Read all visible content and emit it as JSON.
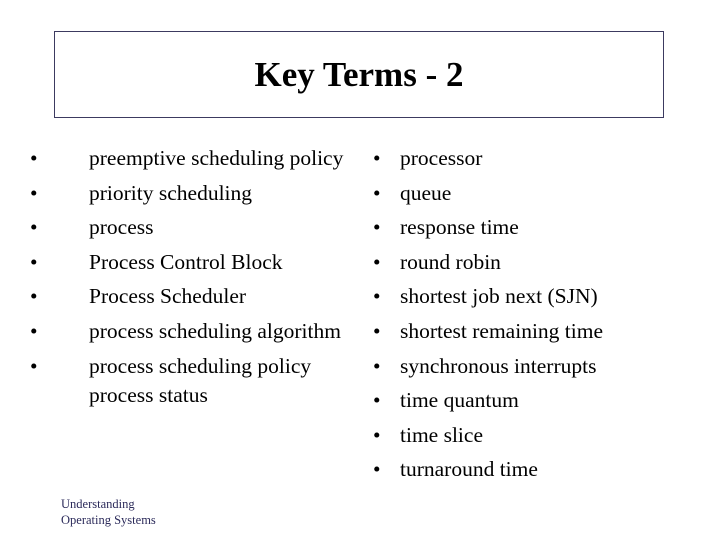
{
  "slide": {
    "title": "Key Terms - 2",
    "bullet_glyph": "•",
    "left_column": [
      "preemptive scheduling policy",
      "priority scheduling",
      "process",
      "Process Control Block",
      "Process Scheduler",
      "process scheduling algorithm",
      "process scheduling policy process status"
    ],
    "right_column": [
      "processor",
      "queue",
      "response time",
      "round robin",
      "shortest job next (SJN)",
      "shortest remaining time",
      "synchronous interrupts",
      "time quantum",
      "time slice",
      "turnaround time"
    ],
    "footer": {
      "line1": "Understanding",
      "line2": "Operating Systems"
    },
    "colors": {
      "title_border": "#3c3a60",
      "footer_text": "#2b2a5a",
      "text": "#000000",
      "background": "#ffffff"
    }
  }
}
